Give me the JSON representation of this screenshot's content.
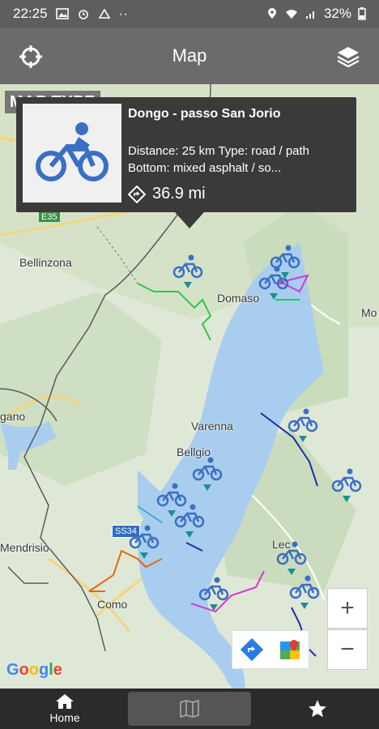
{
  "status_bar": {
    "time": "22:25",
    "battery": "32%"
  },
  "app_bar": {
    "title": "Map",
    "left_icon": "locate-crosshair-icon",
    "right_icon": "layers-icon"
  },
  "map": {
    "map_type_label": "MAP TYPE",
    "places": {
      "bellinzona": "Bellinzona",
      "domaso": "Domaso",
      "varenna": "Varenna",
      "bellagio": "Bellgio",
      "lugano": "gano",
      "mendrisio": "Mendrisio",
      "como": "Como",
      "lecco": "Lec",
      "mo": "Mo",
      "e35": "E35",
      "ss340": "SS34"
    },
    "popup": {
      "title": "Dongo - passo San Jorio",
      "description": "Distance: 25 km  Type: road / path  Bottom: mixed asphalt / so...",
      "distance": "36.9 mi",
      "icon": "bicycle-icon"
    },
    "zoom_in": "+",
    "zoom_out": "−",
    "google_logo": "Google",
    "colors": {
      "marker": "#3b6fc4",
      "marker_pin": "#1a8f96",
      "water": "#a9cdee"
    }
  },
  "bottom_nav": {
    "home_label": "Home",
    "center_icon": "map-book-icon",
    "right_icon": "star-icon"
  }
}
